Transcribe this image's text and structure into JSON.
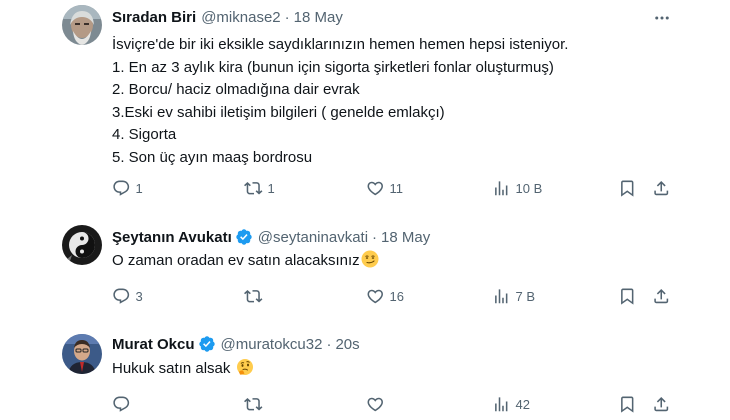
{
  "tweets": [
    {
      "display_name": "Sıradan Biri",
      "handle": "@miknase2",
      "separator": "·",
      "date": "18 May",
      "verified": false,
      "lines": [
        "İsviçre'de bir iki eksikle saydıklarınızın hemen hemen hepsi isteniyor.",
        "1. En az 3 aylık kira (bunun için sigorta şirketleri fonlar oluşturmuş)",
        "2. Borcu/ haciz olmadığına dair evrak",
        "3.Eski ev sahibi iletişim bilgileri ( genelde emlakçı)",
        "4. Sigorta",
        "5. Son üç ayın maaş bordrosu"
      ],
      "replies": "1",
      "retweets": "1",
      "likes": "11",
      "views": "10 B"
    },
    {
      "display_name": "Şeytanın Avukatı",
      "handle": "@seytaninavkati",
      "separator": "·",
      "date": "18 May",
      "verified": true,
      "text": "O zaman oradan ev satın alacaksınız",
      "emoji": "smirking-face",
      "replies": "3",
      "retweets": "",
      "likes": "16",
      "views": "7 B"
    },
    {
      "display_name": "Murat Okcu",
      "handle": "@muratokcu32",
      "separator": "·",
      "date": "20s",
      "verified": true,
      "text": "Hukuk satın alsak",
      "emoji": "thinking-face",
      "replies": "",
      "retweets": "",
      "likes": "",
      "views": "42"
    }
  ],
  "colors": {
    "text": "#0f1419",
    "secondary": "#536471",
    "verified": "#1d9bf0",
    "background": "#ffffff"
  },
  "icons": {
    "reply": "reply-icon",
    "retweet": "retweet-icon",
    "like": "heart-icon",
    "views": "views-icon",
    "bookmark": "bookmark-icon",
    "share": "share-icon",
    "more": "more-icon"
  }
}
